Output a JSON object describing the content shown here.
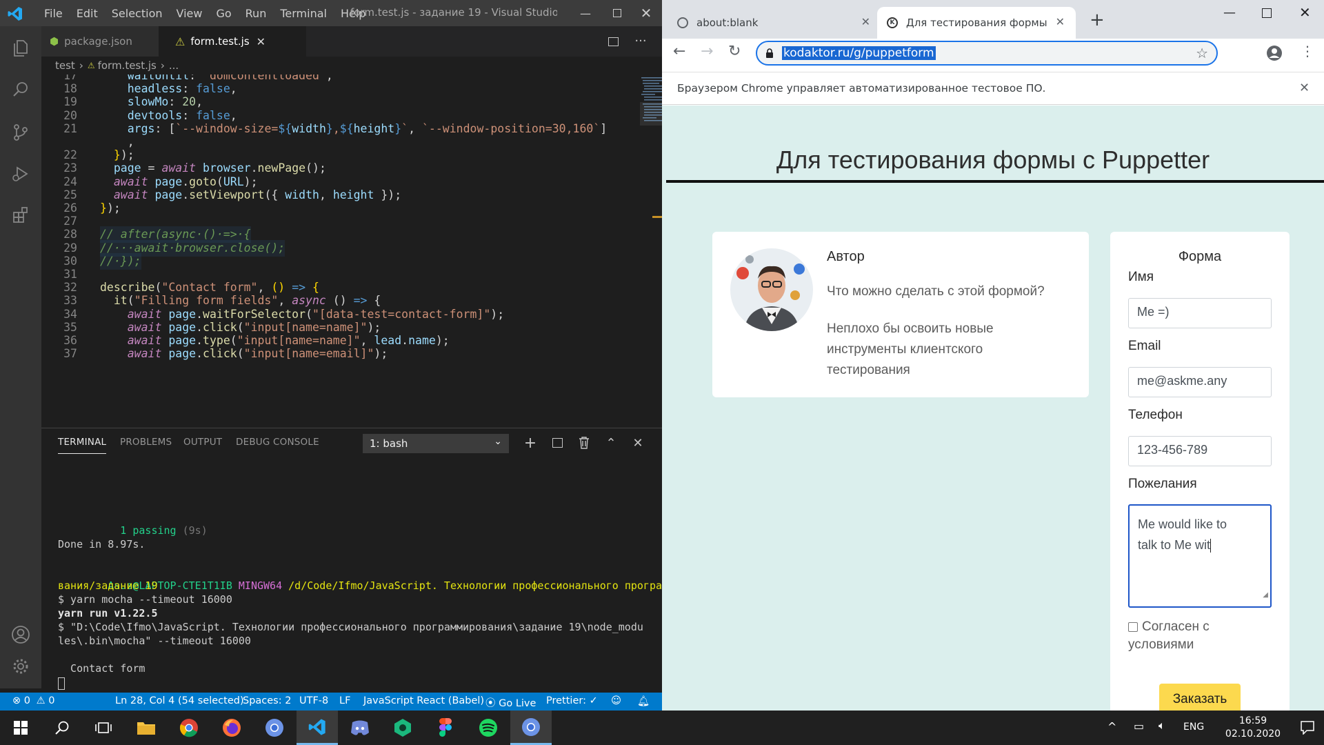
{
  "vscode": {
    "menu": [
      "File",
      "Edit",
      "Selection",
      "View",
      "Go",
      "Run",
      "Terminal",
      "Help"
    ],
    "window_title": "form.test.js - задание 19 - Visual Studio ...",
    "tabs": [
      {
        "label": "package.json"
      },
      {
        "label": "form.test.js"
      }
    ],
    "breadcrumb": [
      "test",
      "form.test.js",
      "..."
    ],
    "code_lines": [
      {
        "n": "17",
        "html": "    <span class='v'>waitUntil</span><span class='w'>: </span><span class='s'>\"domcontentloaded\"</span><span class='w'>,</span>"
      },
      {
        "n": "18",
        "html": "    <span class='v'>headless</span><span class='w'>: </span><span class='b'>false</span><span class='w'>,</span>"
      },
      {
        "n": "19",
        "html": "    <span class='v'>slowMo</span><span class='w'>: </span><span class='n'>20</span><span class='w'>,</span>"
      },
      {
        "n": "20",
        "html": "    <span class='v'>devtools</span><span class='w'>: </span><span class='b'>false</span><span class='w'>,</span>"
      },
      {
        "n": "21",
        "html": "    <span class='v'>args</span><span class='w'>: [</span><span class='s'>`--window-size=</span><span class='b'>${</span><span class='v'>width</span><span class='b'>}</span><span class='s'>,</span><span class='b'>${</span><span class='v'>height</span><span class='b'>}</span><span class='s'>`</span><span class='w'>, </span><span class='s'>`--window-position=30,160`</span><span class='w'>]</span>"
      },
      {
        "n": "",
        "html": "    <span class='w'>,</span>"
      },
      {
        "n": "22",
        "html": "  <span class='y'>}</span><span class='w'>);</span>"
      },
      {
        "n": "23",
        "html": "  <span class='v'>page</span><span class='w'> = </span><span class='k'>await</span><span class='w'> </span><span class='v'>browser</span><span class='w'>.</span><span class='f'>newPage</span><span class='w'>();</span>"
      },
      {
        "n": "24",
        "html": "  <span class='k'>await</span><span class='w'> </span><span class='v'>page</span><span class='w'>.</span><span class='f'>goto</span><span class='w'>(</span><span class='v'>URL</span><span class='w'>);</span>"
      },
      {
        "n": "25",
        "html": "  <span class='k'>await</span><span class='w'> </span><span class='v'>page</span><span class='w'>.</span><span class='f'>setViewport</span><span class='w'>({ </span><span class='v'>width</span><span class='w'>, </span><span class='v'>height</span><span class='w'> });</span>"
      },
      {
        "n": "26",
        "html": "<span class='y'>}</span><span class='w'>);</span>"
      },
      {
        "n": "27",
        "html": ""
      },
      {
        "n": "28",
        "html": "<span class='c'>// after(async·()·=>·{</span>"
      },
      {
        "n": "29",
        "html": "<span class='c'>//···await·browser.close();</span>"
      },
      {
        "n": "30",
        "html": "<span class='c'>//·});</span>"
      },
      {
        "n": "31",
        "html": ""
      },
      {
        "n": "32",
        "html": "<span class='f'>describe</span><span class='w'>(</span><span class='s'>\"Contact form\"</span><span class='w'>, </span><span class='y'>()</span><span class='w'> </span><span class='b'>=&gt;</span><span class='w'> </span><span class='y'>{</span>"
      },
      {
        "n": "33",
        "html": "  <span class='f'>it</span><span class='w'>(</span><span class='s'>\"Filling form fields\"</span><span class='w'>, </span><span class='k'>async</span><span class='w'> () </span><span class='b'>=&gt;</span><span class='w'> {</span>"
      },
      {
        "n": "34",
        "html": "    <span class='k'>await</span><span class='w'> </span><span class='v'>page</span><span class='w'>.</span><span class='f'>waitForSelector</span><span class='w'>(</span><span class='s'>\"[data-test=contact-form]\"</span><span class='w'>);</span>"
      },
      {
        "n": "35",
        "html": "    <span class='k'>await</span><span class='w'> </span><span class='v'>page</span><span class='w'>.</span><span class='f'>click</span><span class='w'>(</span><span class='s'>\"input[name=name]\"</span><span class='w'>);</span>"
      },
      {
        "n": "36",
        "html": "    <span class='k'>await</span><span class='w'> </span><span class='v'>page</span><span class='w'>.</span><span class='f'>type</span><span class='w'>(</span><span class='s'>\"input[name=name]\"</span><span class='w'>, </span><span class='v'>lead</span><span class='w'>.</span><span class='v'>name</span><span class='w'>);</span>"
      },
      {
        "n": "37",
        "html": "    <span class='k'>await</span><span class='w'> </span><span class='v'>page</span><span class='w'>.</span><span class='f'>click</span><span class='w'>(</span><span class='s'>\"input[name=email]\"</span><span class='w'>);</span>"
      }
    ],
    "panel_tabs": [
      "TERMINAL",
      "PROBLEMS",
      "OUTPUT",
      "DEBUG CONSOLE"
    ],
    "terminal_select": "1: bash",
    "terminal": {
      "passing": "  1 passing",
      "passing_time": " (9s)",
      "done": "Done in 8.97s.",
      "prompt_user": "Asus@LAPTOP-CTE1T1IB",
      "prompt_env": "MINGW64",
      "prompt_path1": "/d/Code/Ifmo/JavaScript. Технологии профессионального программиро",
      "prompt_path2": "вания/задание 19",
      "cmd": "$ yarn mocha --timeout 16000",
      "yarn_run": "yarn run v1.22.5",
      "exec1": "$ \"D:\\Code\\Ifmo\\JavaScript. Технологии профессионального программирования\\задание 19\\node_modu",
      "exec2": "les\\.bin\\mocha\" --timeout 16000",
      "suite": "  Contact form"
    },
    "status": {
      "errors": "0",
      "warnings": "0",
      "position": "Ln 28, Col 4 (54 selected)",
      "spaces": "Spaces: 2",
      "encoding": "UTF-8",
      "eol": "LF",
      "language": "JavaScript React (Babel)",
      "golive": "Go Live",
      "prettier": "Prettier: ✓"
    }
  },
  "chrome": {
    "tabs": [
      {
        "label": "about:blank"
      },
      {
        "label": "Для тестирования формы с Pup"
      }
    ],
    "url": "kodaktor.ru/g/puppetform",
    "infobar": "Браузером Chrome управляет автоматизированное тестовое ПО.",
    "page": {
      "title": "Для тестирования формы с Puppetter",
      "author": {
        "heading": "Автор",
        "question": "Что можно сделать с этой формой?",
        "answer_lines": [
          "Неплохо бы освоить новые",
          "инструменты клиентского",
          "тестирования"
        ]
      },
      "form": {
        "heading": "Форма",
        "name_label": "Имя",
        "name_value": "Me =)",
        "email_label": "Email",
        "email_value": "me@askme.any",
        "phone_label": "Телефон",
        "phone_value": "123-456-789",
        "wishes_label": "Пожелания",
        "wishes_lines": [
          "Me would like to",
          "talk to Me wit"
        ],
        "agree_lines": [
          "Согласен с",
          "условиями"
        ],
        "submit": "Заказать"
      }
    }
  },
  "taskbar": {
    "lang": "ENG",
    "time": "16:59",
    "date": "02.10.2020"
  },
  "colors": {
    "vscode_status": "#007acc",
    "page_bg": "#dbefed",
    "submit": "#fcd94e",
    "omnibox_focus": "#1a73e8"
  }
}
